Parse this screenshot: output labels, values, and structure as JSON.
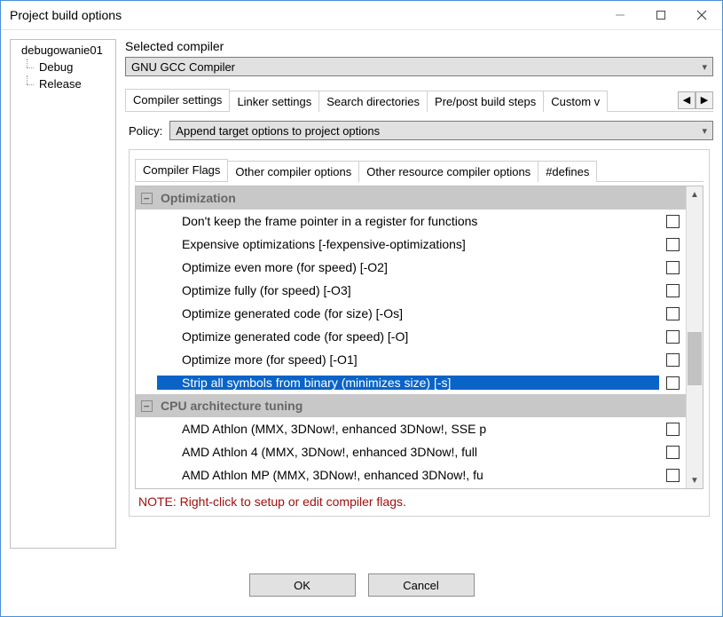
{
  "window": {
    "title": "Project build options"
  },
  "tree": {
    "root": "debugowanie01",
    "children": [
      "Debug",
      "Release"
    ]
  },
  "compiler_section": {
    "label": "Selected compiler",
    "value": "GNU GCC Compiler"
  },
  "main_tabs": {
    "active": 0,
    "items": [
      "Compiler settings",
      "Linker settings",
      "Search directories",
      "Pre/post build steps",
      "Custom v"
    ]
  },
  "policy": {
    "label": "Policy:",
    "value": "Append target options to project options"
  },
  "sub_tabs": {
    "active": 0,
    "items": [
      "Compiler Flags",
      "Other compiler options",
      "Other resource compiler options",
      "#defines"
    ]
  },
  "flags": {
    "groups": [
      {
        "title": "Optimization",
        "items": [
          {
            "label": "Don't keep the frame pointer in a register for functions",
            "checked": false,
            "selected": false
          },
          {
            "label": "Expensive optimizations  [-fexpensive-optimizations]",
            "checked": false,
            "selected": false
          },
          {
            "label": "Optimize even more (for speed)  [-O2]",
            "checked": false,
            "selected": false
          },
          {
            "label": "Optimize fully (for speed)  [-O3]",
            "checked": false,
            "selected": false
          },
          {
            "label": "Optimize generated code (for size)  [-Os]",
            "checked": false,
            "selected": false
          },
          {
            "label": "Optimize generated code (for speed)  [-O]",
            "checked": false,
            "selected": false
          },
          {
            "label": "Optimize more (for speed)  [-O1]",
            "checked": false,
            "selected": false
          },
          {
            "label": "Strip all symbols from binary (minimizes size)  [-s]",
            "checked": false,
            "selected": true
          }
        ]
      },
      {
        "title": "CPU architecture tuning",
        "items": [
          {
            "label": "AMD Athlon (MMX, 3DNow!, enhanced 3DNow!, SSE p",
            "checked": false,
            "selected": false
          },
          {
            "label": "AMD Athlon 4 (MMX, 3DNow!, enhanced 3DNow!, full",
            "checked": false,
            "selected": false
          },
          {
            "label": "AMD Athlon MP (MMX, 3DNow!, enhanced 3DNow!, fu",
            "checked": false,
            "selected": false
          }
        ]
      }
    ]
  },
  "note": "NOTE: Right-click to setup or edit compiler flags.",
  "buttons": {
    "ok": "OK",
    "cancel": "Cancel"
  }
}
